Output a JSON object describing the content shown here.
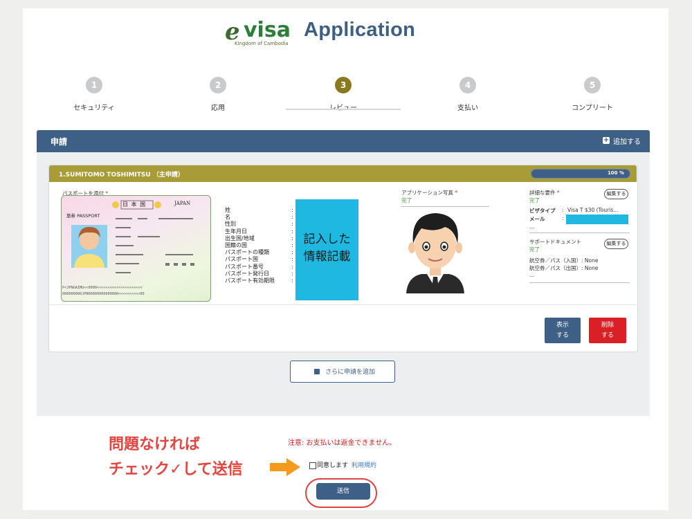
{
  "header": {
    "logo_e": "e",
    "logo_visa": "visa",
    "logo_sub": "Kingdom of Cambodia",
    "title": "Application"
  },
  "steps": [
    {
      "num": "1",
      "label": "セキュリティ"
    },
    {
      "num": "2",
      "label": "応用"
    },
    {
      "num": "3",
      "label": "レビュー"
    },
    {
      "num": "4",
      "label": "支払い"
    },
    {
      "num": "5",
      "label": "コンプリート"
    }
  ],
  "panel": {
    "title": "申請",
    "add_label": "追加する",
    "add_icon": "plus-square-icon"
  },
  "applicant": {
    "title": "1.SUMITOMO TOSHIMITSU （主申請）",
    "progress_text": "100 %",
    "progress_fraction": 1.0,
    "passport_label": "パスポートを添付",
    "passport": {
      "jp_title": "日 本 国",
      "country": "JAPAN",
      "type": "旅券 PASSPORT",
      "mrz1": "P<JPNGAIMU<<0000<<<<<<<<<<<<<<<<<<<<<",
      "mrz2": "000000000JPN00000000000000<<<<<<<<<<00"
    },
    "fields": [
      "姓",
      "名",
      "性別",
      "生年月日",
      "出生国/地域",
      "国籍の国",
      "パスポートの種類",
      "パスポート国",
      "パスポート番号",
      "パスポート発行日",
      "パスポート有効期限"
    ],
    "blue_box_line1": "記入した",
    "blue_box_line2": "情報記載",
    "photo_label": "アプリケーション写真",
    "photo_status": "完了",
    "details_label": "詳細な要件",
    "details_status": "完了",
    "edit_label": "編集する",
    "visa_type_label": "ビザタイプ",
    "visa_type_value": "Visa T $30 (Touris...",
    "mail_label": "メール",
    "ellipsis": "...",
    "support_label": "サポートドキュメント",
    "support_status": "完了",
    "ticket_in_label": "航空券／パス（入国）: None",
    "ticket_out_label": "航空券／パス（出国）: None",
    "show_btn_1": "表示",
    "show_btn_2": "する",
    "del_btn_1": "削除",
    "del_btn_2": "する",
    "required_mark": "*",
    "colon": ":"
  },
  "add_more_label": "さらに申請を追加",
  "annotation": {
    "line1": "問題なければ",
    "line2": "チェック✓して送信"
  },
  "note": "注意: お支払いは返金できません。",
  "agree_label": "同意します",
  "terms_label": "利用規約",
  "submit_label": "送信",
  "colors": {
    "brand_blue": "#3e5f86",
    "olive": "#a79c37",
    "annotation_red": "#e7433e",
    "delete_red": "#db1f26",
    "highlight_cyan": "#1fb8e0",
    "arrow_orange": "#f39a1f"
  }
}
